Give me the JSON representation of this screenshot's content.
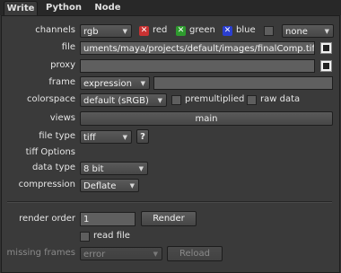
{
  "tabs": [
    "Write",
    "Python",
    "Node"
  ],
  "labels": {
    "channels": "channels",
    "file": "file",
    "proxy": "proxy",
    "frame": "frame",
    "colorspace": "colorspace",
    "views": "views",
    "file_type": "file type",
    "tiff_options": "tiff Options",
    "data_type": "data type",
    "compression": "compression",
    "render_order": "render order",
    "missing_frames": "missing frames"
  },
  "channels": {
    "value": "rgb",
    "red": "red",
    "green": "green",
    "blue": "blue",
    "alpha_value": "none",
    "colors": {
      "red": "#c83232",
      "green": "#2e9b2e",
      "blue": "#2b3fd0"
    }
  },
  "file": {
    "value": "uments/maya/projects/default/images/finalComp.tif"
  },
  "proxy": {
    "value": ""
  },
  "frame": {
    "mode": "expression",
    "value": ""
  },
  "colorspace": {
    "value": "default (sRGB)",
    "premultiplied": "premultiplied",
    "raw_data": "raw data"
  },
  "views": {
    "value": "main"
  },
  "file_type": {
    "value": "tiff",
    "help": "?"
  },
  "data_type": {
    "value": "8 bit"
  },
  "compression": {
    "value": "Deflate"
  },
  "render": {
    "order": "1",
    "button": "Render",
    "read_file": "read file"
  },
  "missing_frames": {
    "value": "error",
    "reload": "Reload"
  }
}
